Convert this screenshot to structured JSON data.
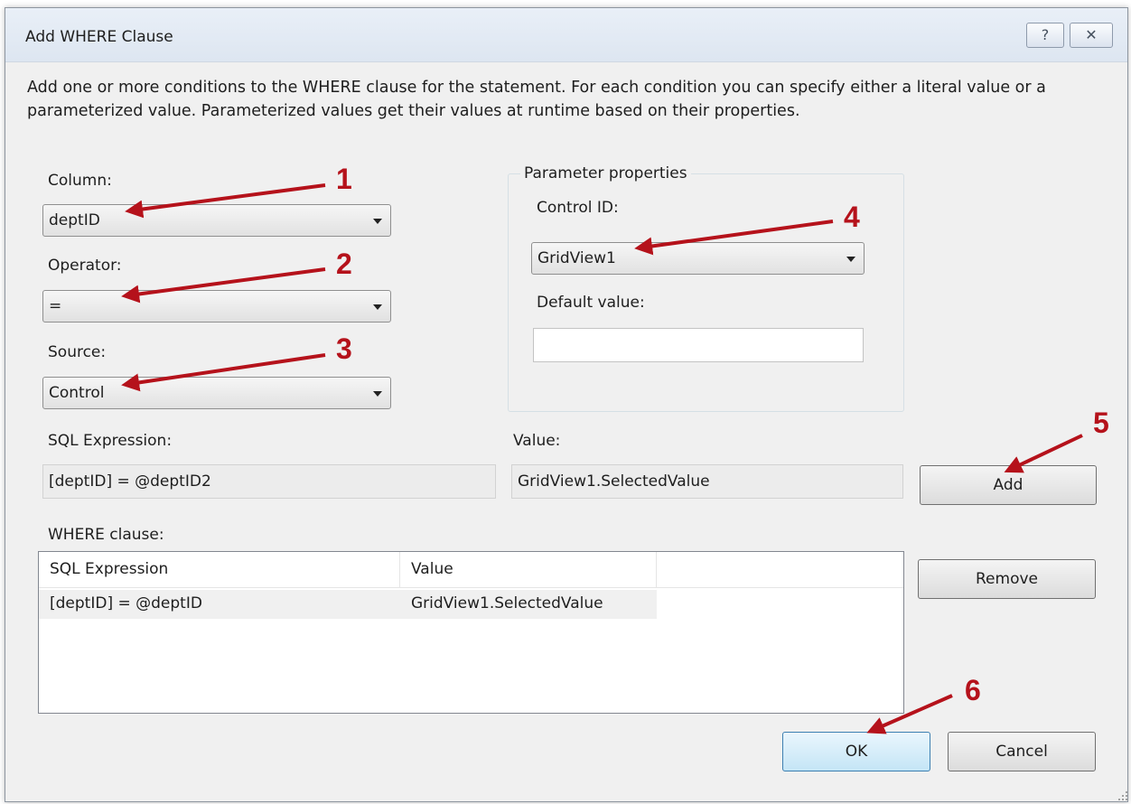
{
  "dialog": {
    "title": "Add WHERE Clause",
    "help_glyph": "?",
    "close_glyph": "✕",
    "description": "Add one or more conditions to the WHERE clause for the statement. For each condition you can specify either a literal value or a parameterized value. Parameterized values get their values at runtime based on their properties."
  },
  "column": {
    "label": "Column:",
    "value": "deptID"
  },
  "operator": {
    "label": "Operator:",
    "value": "="
  },
  "source": {
    "label": "Source:",
    "value": "Control"
  },
  "parameter_properties": {
    "legend": "Parameter properties",
    "control_id_label": "Control ID:",
    "control_id_value": "GridView1",
    "default_value_label": "Default value:",
    "default_value": ""
  },
  "sql_expression": {
    "label": "SQL Expression:",
    "value": "[deptID] = @deptID2"
  },
  "value_field": {
    "label": "Value:",
    "value": "GridView1.SelectedValue"
  },
  "buttons": {
    "add": "Add",
    "remove": "Remove",
    "ok": "OK",
    "cancel": "Cancel"
  },
  "where_clause": {
    "label": "WHERE clause:",
    "columns": [
      "SQL Expression",
      "Value"
    ],
    "rows": [
      {
        "expression": "[deptID] = @deptID",
        "value": "GridView1.SelectedValue"
      }
    ]
  },
  "annotations": [
    "1",
    "2",
    "3",
    "4",
    "5",
    "6"
  ],
  "colors": {
    "annotation": "#b5121b",
    "dialog_bg": "#f0f0f0",
    "titlebar": "#dde6f1"
  }
}
